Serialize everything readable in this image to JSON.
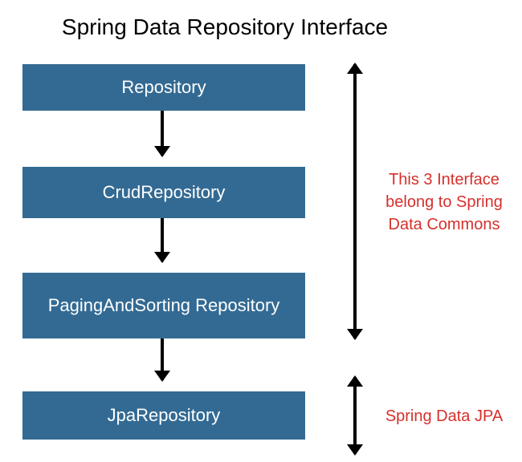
{
  "title": "Spring Data Repository Interface",
  "boxes": {
    "repository": "Repository",
    "crud": "CrudRepository",
    "paging": "PagingAndSorting Repository",
    "jpa": "JpaRepository"
  },
  "annotations": {
    "commons": "This 3 Interface belong to Spring Data Commons",
    "jpa": "Spring Data JPA"
  },
  "colors": {
    "box_bg": "#336a93",
    "box_text": "#ffffff",
    "annotation": "#d6302c",
    "arrow": "#000000"
  }
}
